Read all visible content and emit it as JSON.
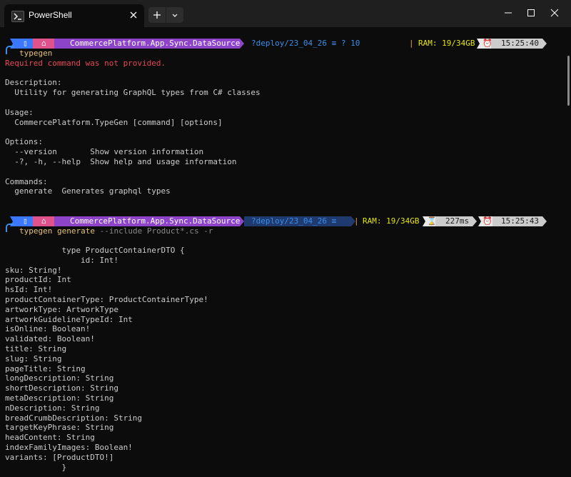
{
  "window": {
    "tab_title": "PowerShell",
    "colors": {
      "bg": "#0c0c0c",
      "titlebar": "#1f1f1f",
      "error": "#e74856",
      "command": "#e5c07b"
    }
  },
  "prompt1": {
    "path": "CommercePlatform.App.Sync.DataSource",
    "branch": "?deploy/23_04_26 ≡ ? 10",
    "ram": "RAM: 19/34GB",
    "time": "15:25:40"
  },
  "cmd1": {
    "text": "typegen"
  },
  "out1": [
    "Required command was not provided.",
    "",
    "Description:",
    "  Utility for generating GraphQL types from C# classes",
    "",
    "Usage:",
    "  CommercePlatform.TypeGen [command] [options]",
    "",
    "Options:",
    "  --version       Show version information",
    "  -?, -h, --help  Show help and usage information",
    "",
    "Commands:",
    "  generate  Generates graphql types"
  ],
  "prompt2": {
    "path": "CommercePlatform.App.Sync.DataSource",
    "branch": "?deploy/23_04_26 ≡",
    "ram": "RAM: 19/34GB",
    "duration": "227ms",
    "time": "15:25:43"
  },
  "cmd2": {
    "program": "typegen",
    "sub": "generate",
    "args": "--include Product*.cs -r"
  },
  "out2": [
    "            type ProductContainerDTO {",
    "                id: Int!",
    "sku: String!",
    "productId: Int",
    "hsId: Int!",
    "productContainerType: ProductContainerType!",
    "artworkType: ArtworkType",
    "artworkGuidelineTypeId: Int",
    "isOnline: Boolean!",
    "validated: Boolean!",
    "title: String",
    "slug: String",
    "pageTitle: String",
    "longDescription: String",
    "shortDescription: String",
    "metaDescription: String",
    "nDescription: String",
    "breadCrumbDescription: String",
    "targetKeyPhrase: String",
    "headContent: String",
    "indexFamilyImages: Boolean!",
    "variants: [ProductDTO!]",
    "            }"
  ]
}
